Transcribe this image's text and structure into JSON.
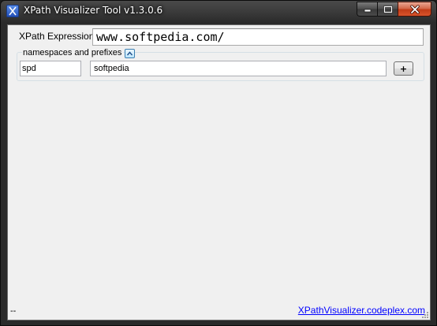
{
  "window": {
    "title": "XPath Visualizer Tool v1.3.0.6",
    "app_icon_glyph": "X",
    "icons": {
      "app": "xpath-app-icon",
      "minimize": "minimize-icon",
      "maximize": "maximize-icon",
      "close": "close-icon"
    }
  },
  "xpath": {
    "label": "XPath Expression",
    "value": "www.softpedia.com/"
  },
  "namespaces": {
    "legend": "namespaces and prefixes",
    "collapse_icon": "chevron-up-icon",
    "rows": [
      {
        "prefix": "spd",
        "uri": "softpedia"
      }
    ],
    "add_label": "+"
  },
  "status": {
    "text": "--",
    "link": "XPathVisualizer.codeplex.com"
  },
  "colors": {
    "client_bg": "#f0f0f0",
    "link": "#0000ff",
    "close_button": "#c23c18"
  }
}
